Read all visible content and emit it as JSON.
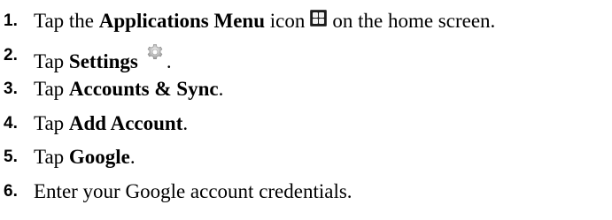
{
  "steps": [
    {
      "number": "1.",
      "prefix": "Tap the ",
      "bold": "Applications Menu",
      "mid": " icon",
      "icon": "applications-menu-icon",
      "suffix": "on the home screen."
    },
    {
      "number": "2.",
      "prefix": "Tap ",
      "bold": "Settings",
      "icon": "settings-gear-icon",
      "suffix": "."
    },
    {
      "number": "3.",
      "prefix": "Tap ",
      "bold": "Accounts & Sync",
      "suffix": "."
    },
    {
      "number": "4.",
      "prefix": "Tap ",
      "bold": "Add Account",
      "suffix": "."
    },
    {
      "number": "5.",
      "prefix": "Tap ",
      "bold": "Google",
      "suffix": "."
    },
    {
      "number": "6.",
      "prefix": "Enter your Google account credentials."
    }
  ]
}
